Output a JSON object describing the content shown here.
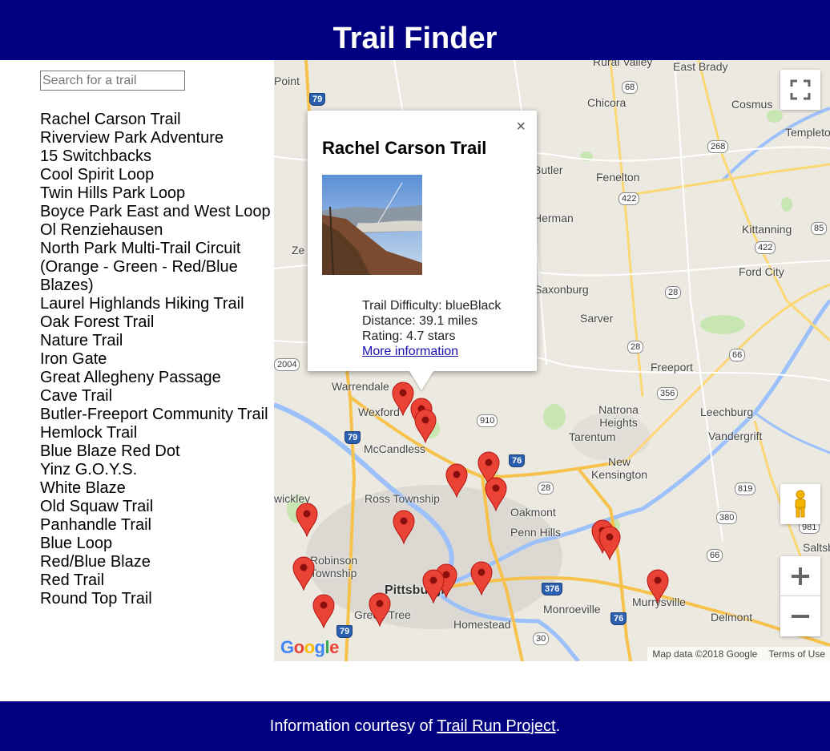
{
  "header": {
    "title": "Trail Finder"
  },
  "sidebar": {
    "search_placeholder": "Search for a trail",
    "trails": [
      "Rachel Carson Trail",
      "Riverview Park Adventure",
      "15 Switchbacks",
      "Cool Spirit Loop",
      "Twin Hills Park Loop",
      "Boyce Park East and West Loop",
      "Ol Renziehausen",
      "North Park Multi-Trail Circuit (Orange - Green - Red/Blue Blazes)",
      "Laurel Highlands Hiking Trail",
      "Oak Forest Trail",
      "Nature Trail",
      "Iron Gate",
      "Great Allegheny Passage",
      "Cave Trail",
      "Butler-Freeport Community Trail",
      "Hemlock Trail",
      "Blue Blaze Red Dot",
      "Yinz G.O.Y.S.",
      "White Blaze",
      "Old Squaw Trail",
      "Panhandle Trail",
      "Blue Loop",
      "Red/Blue Blaze",
      "Red Trail",
      "Round Top Trail"
    ]
  },
  "map": {
    "places": {
      "rural_city": "Rural Valley",
      "east_brady": "East Brady",
      "chicora": "Chicora",
      "cosmus": "Cosmus",
      "templeton": "Templeton",
      "fenelton": "Fenelton",
      "butler": "Butler",
      "herman": "Herman",
      "kittanning": "Kittanning",
      "ford_city": "Ford City",
      "saxonburg": "Saxonburg",
      "sarver": "Sarver",
      "freeport": "Freeport",
      "leechburg": "Leechburg",
      "natrona": "Natrona Heights",
      "tarentum": "Tarentum",
      "vandergrift": "Vandergrift",
      "new_kensington": "New Kensington",
      "warrendale": "Warrendale",
      "wexford": "Wexford",
      "mccandless": "McCandless",
      "ross": "Ross Township",
      "oakmont": "Oakmont",
      "penn_hills": "Penn Hills",
      "pittsburgh": "Pittsburgh",
      "robinson": "Robinson Township",
      "green_tree": "Green Tree",
      "homestead": "Homestead",
      "monroeville": "Monroeville",
      "murrysville": "Murrysville",
      "delmont": "Delmont",
      "saltsburg": "Saltsburg",
      "zelienople": "Ze",
      "portersville": "Point",
      "wickley": "wickley"
    },
    "shields": {
      "s79n": "79",
      "s68": "68",
      "s268": "268",
      "s422a": "422",
      "s422b": "422",
      "s85": "85",
      "s28a": "28",
      "s28b": "28",
      "s28c": "28",
      "s66a": "66",
      "s66b": "66",
      "s356": "356",
      "s2004": "2004",
      "s910": "910",
      "s79s": "79",
      "s76a": "76",
      "s819": "819",
      "s380": "380",
      "s981": "981",
      "s376": "376",
      "s76b": "76",
      "s30": "30",
      "s79c": "79"
    },
    "google_logo": "Google",
    "attribution": {
      "data": "Map data ©2018 Google",
      "terms": "Terms of Use"
    }
  },
  "infowindow": {
    "title": "Rachel Carson Trail",
    "close": "×",
    "difficulty": "Trail Difficulty: blueBlack",
    "distance": "Distance: 39.1 miles",
    "rating": "Rating: 4.7 stars",
    "more_info": "More information"
  },
  "footer": {
    "prefix": "Information courtesy of ",
    "link": "Trail Run Project",
    "suffix": "."
  },
  "colors": {
    "banner": "#000080",
    "marker": "#ea4335",
    "link": "#1a0dab"
  }
}
